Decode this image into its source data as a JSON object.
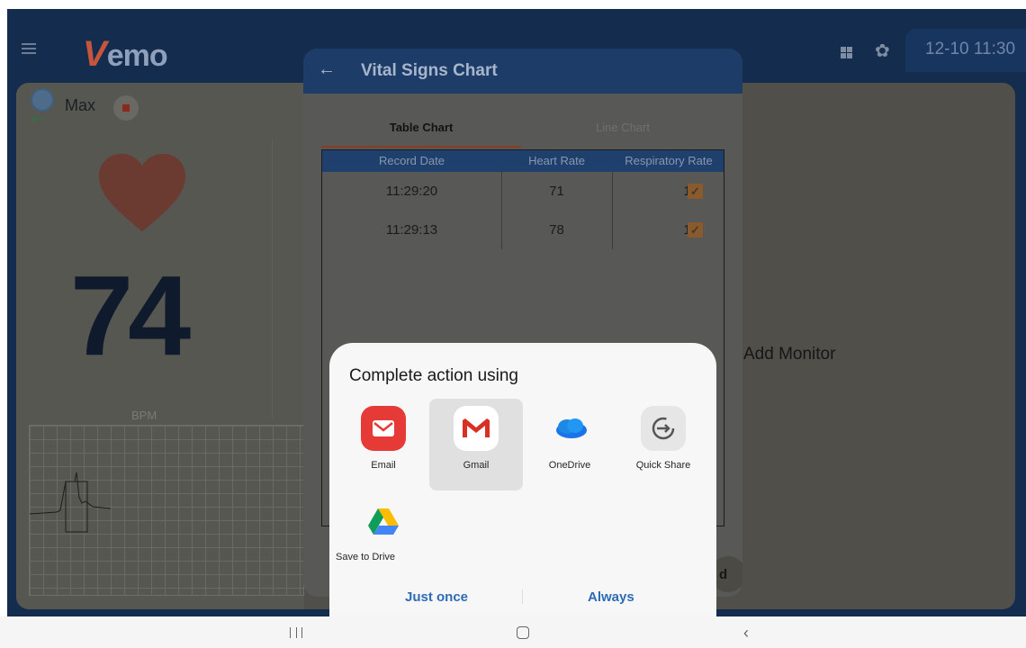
{
  "app": {
    "logo_v": "V",
    "logo_rest": "emo",
    "clock": "12-10 11:30"
  },
  "patient": {
    "name": "Max",
    "sub": "✱♥",
    "heart_rate": "74",
    "unit": "BPM"
  },
  "add_monitor": "Add Monitor",
  "vital_signs": {
    "title": "Vital Signs Chart",
    "tabs": [
      {
        "label": "Table Chart",
        "selected": true
      },
      {
        "label": "Line Chart",
        "selected": false
      }
    ],
    "columns": [
      "Record Date",
      "Heart Rate",
      "Respiratory Rate"
    ],
    "rows": [
      {
        "date": "11:29:20",
        "hr": "71",
        "rr": "15",
        "checked": true
      },
      {
        "date": "11:29:13",
        "hr": "78",
        "rr": "15",
        "checked": true
      }
    ],
    "fab_partial": "d"
  },
  "chooser": {
    "title": "Complete action using",
    "apps": [
      {
        "label": "Email",
        "icon": "email-app-icon",
        "selected": false
      },
      {
        "label": "Gmail",
        "icon": "gmail-app-icon",
        "selected": true
      },
      {
        "label": "OneDrive",
        "icon": "onedrive-app-icon",
        "selected": false
      },
      {
        "label": "Quick Share",
        "icon": "quick-share-app-icon",
        "selected": false
      },
      {
        "label": "Save to Drive",
        "icon": "google-drive-app-icon",
        "selected": false
      }
    ],
    "just_once": "Just once",
    "always": "Always"
  },
  "colors": {
    "accent_blue": "#2e6bb5",
    "header_navy": "#1d3c68",
    "check_orange": "#e8772e",
    "heart_red": "#c94a3a"
  }
}
